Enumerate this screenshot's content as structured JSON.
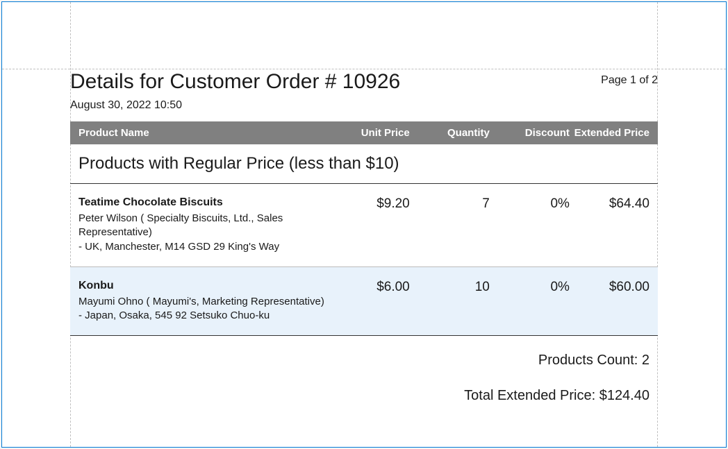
{
  "header": {
    "title": "Details for Customer Order # 10926",
    "page_indicator": "Page 1 of 2",
    "date": "August 30, 2022 10:50"
  },
  "columns": {
    "name": "Product Name",
    "unit": "Unit Price",
    "qty": "Quantity",
    "disc": "Discount",
    "ext": "Extended Price"
  },
  "group": {
    "title": "Products with Regular Price (less than $10)"
  },
  "rows": [
    {
      "product": "Teatime Chocolate Biscuits",
      "contact_line": "Peter Wilson ( Specialty Biscuits, Ltd., Sales Representative)",
      "address_line": "-  UK, Manchester, M14 GSD  29 King's Way",
      "unit_price": "$9.20",
      "quantity": "7",
      "discount": "0%",
      "extended": "$64.40"
    },
    {
      "product": "Konbu",
      "contact_line": "Mayumi Ohno ( Mayumi's, Marketing Representative)",
      "address_line": "-  Japan, Osaka, 545  92 Setsuko Chuo-ku",
      "unit_price": "$6.00",
      "quantity": "10",
      "discount": "0%",
      "extended": "$60.00"
    }
  ],
  "summary": {
    "count_label": "Products Count: 2",
    "total_label": "Total Extended Price: $124.40"
  }
}
